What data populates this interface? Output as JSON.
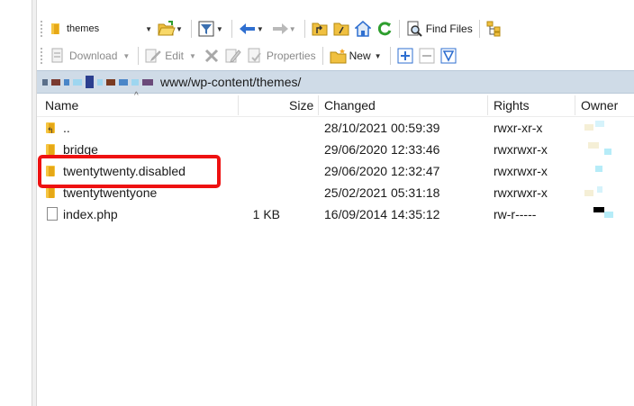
{
  "toolbar_top": {
    "location_combo": "themes",
    "find_files_label": "Find Files"
  },
  "toolbar_bottom": {
    "download_label": "Download",
    "edit_label": "Edit",
    "properties_label": "Properties",
    "new_label": "New"
  },
  "path_bar": {
    "path_suffix": "www/wp-content/themes/"
  },
  "columns": {
    "name": "Name",
    "size": "Size",
    "changed": "Changed",
    "rights": "Rights",
    "owner": "Owner"
  },
  "files": [
    {
      "name": "..",
      "size": "",
      "changed": "28/10/2021 00:59:39",
      "rights": "rwxr-xr-x",
      "icon": "parent-folder-icon"
    },
    {
      "name": "bridge",
      "size": "",
      "changed": "29/06/2020 12:33:46",
      "rights": "rwxrwxr-x",
      "icon": "folder-icon"
    },
    {
      "name": "twentytwenty.disabled",
      "size": "",
      "changed": "29/06/2020 12:32:47",
      "rights": "rwxrwxr-x",
      "icon": "folder-icon"
    },
    {
      "name": "twentytwentyone",
      "size": "",
      "changed": "25/02/2021 05:31:18",
      "rights": "rwxrwxr-x",
      "icon": "folder-icon"
    },
    {
      "name": "index.php",
      "size": "1 KB",
      "changed": "16/09/2014 14:35:12",
      "rights": "rw-r-----",
      "icon": "file-icon"
    }
  ],
  "colors": {
    "highlight": "#ee1111",
    "path_bar": "#cfdbe7"
  }
}
